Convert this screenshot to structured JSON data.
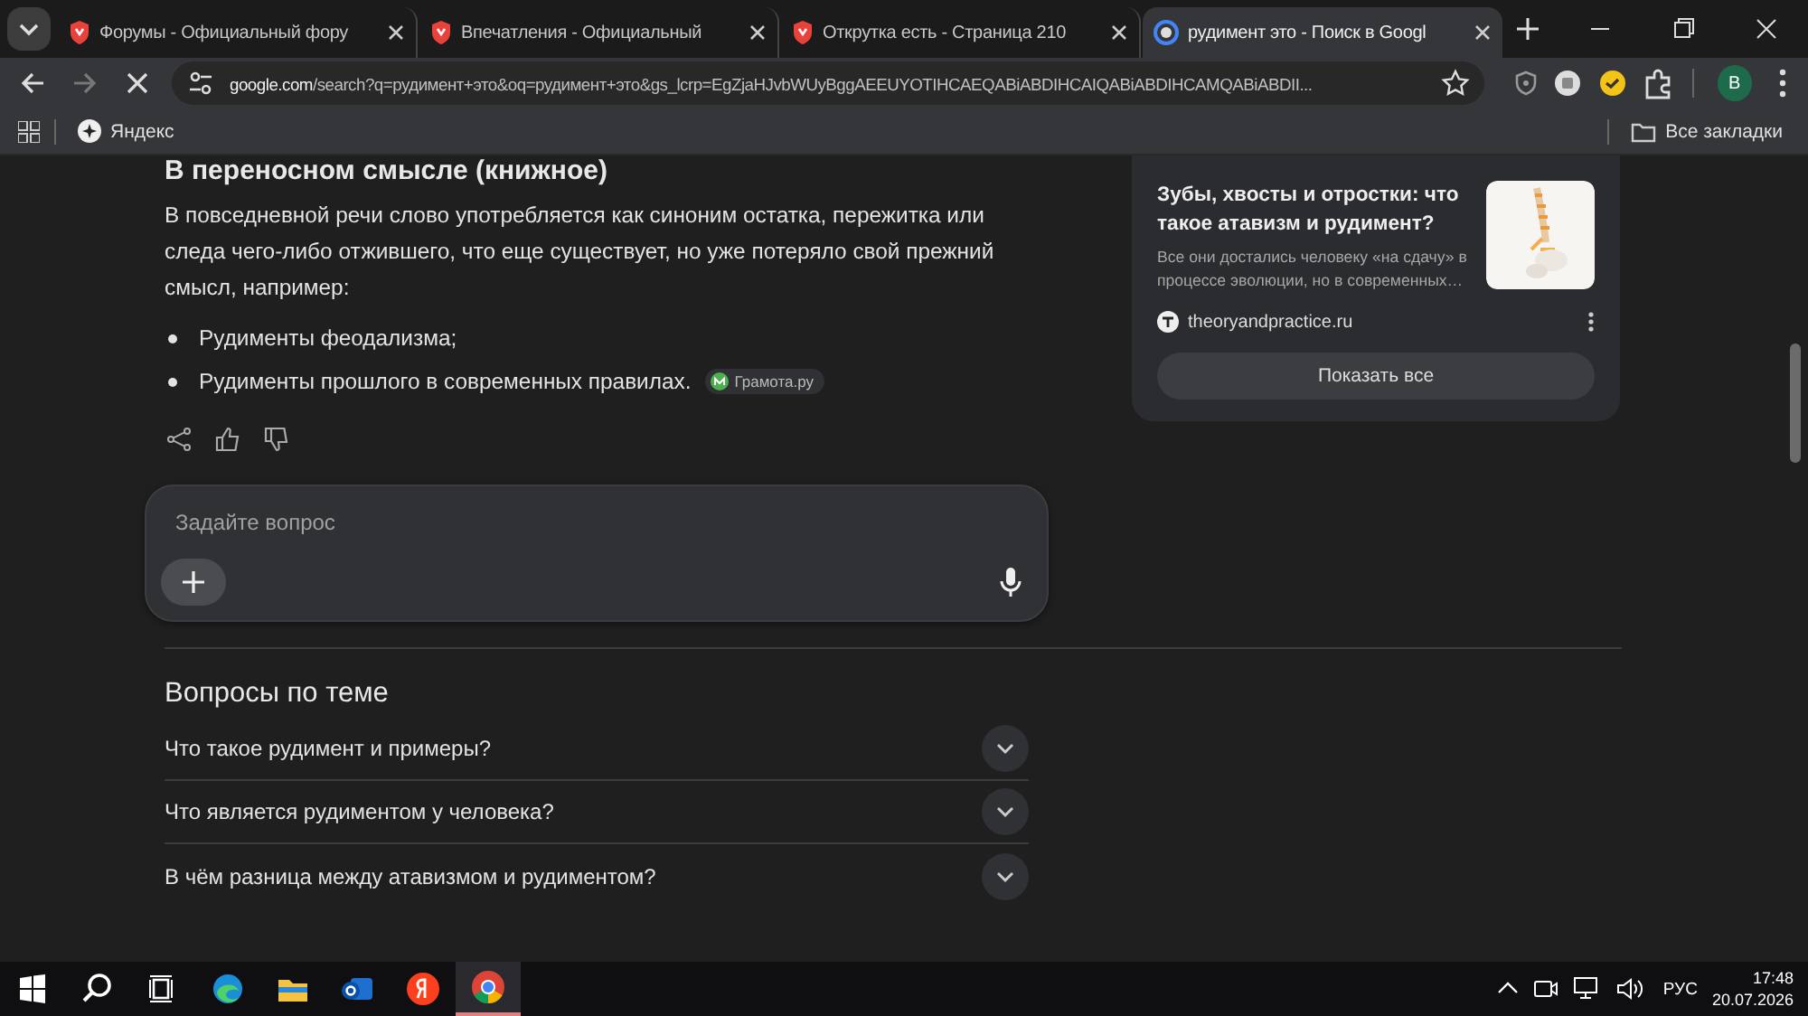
{
  "tabs": [
    {
      "kind": "shield",
      "title": "Форумы - Официальный фору",
      "selected": false
    },
    {
      "kind": "shield",
      "title": "Впечатления - Официальный",
      "selected": false
    },
    {
      "kind": "shield",
      "title": "Открутка есть - Страница 210",
      "selected": false
    },
    {
      "kind": "google",
      "title": "рудимент это - Поиск в Googl",
      "selected": true
    }
  ],
  "address_bar": {
    "host": "google.com",
    "path": "/search?q=рудимент+это&oq=рудимент+это&gs_lcrp=EgZjaHJvbWUyBggAEEUYOTIHCAEQABiABDIHCAIQABiABDIHCAMQABiABDII..."
  },
  "profile": {
    "initial": "B"
  },
  "bookmarks": {
    "items": [
      "Яндекс"
    ],
    "all": "Все закладки"
  },
  "answer": {
    "heading": "В переносном смысле (книжное)",
    "paragraph": "В повседневной речи слово употребляется как синоним остатка, пережитка или следа чего-либо отжившего, что еще существует, но уже потеряло свой прежний смысл, например:",
    "bullets": [
      {
        "text": "Рудименты феодализма;"
      },
      {
        "text": "Рудименты прошлого в современных правилах.",
        "source": "Грамота.ру"
      }
    ]
  },
  "ask_box": {
    "placeholder": "Задайте вопрос"
  },
  "related_questions": {
    "title": "Вопросы по теме",
    "items": [
      {
        "text": "Что такое рудимент и примеры?",
        "expanded": false
      },
      {
        "text": "Что является рудиментом у человека?",
        "expanded": false
      },
      {
        "text": "В чём разница между атавизмом и рудиментом?",
        "expanded": false
      }
    ]
  },
  "source_card": {
    "title": "Зубы, хвосты и отростки: что такое атавизм и рудимент?",
    "snippet": "Все они достались человеку «на сдачу» в процессе эволюции, но в современных…",
    "site": "theoryandpractice.ru",
    "button": "Показать все"
  },
  "taskbar": {
    "apps": [
      {
        "kind": "windows",
        "active": false
      },
      {
        "kind": "search",
        "active": false
      },
      {
        "kind": "taskview",
        "active": false
      },
      {
        "kind": "edge",
        "active": false
      },
      {
        "kind": "explorer",
        "active": false
      },
      {
        "kind": "mail",
        "active": false
      },
      {
        "kind": "yandex",
        "active": false
      },
      {
        "kind": "chrome",
        "active": true
      }
    ],
    "language": "РУС",
    "time": "17:48",
    "date": "20.07.2026"
  }
}
